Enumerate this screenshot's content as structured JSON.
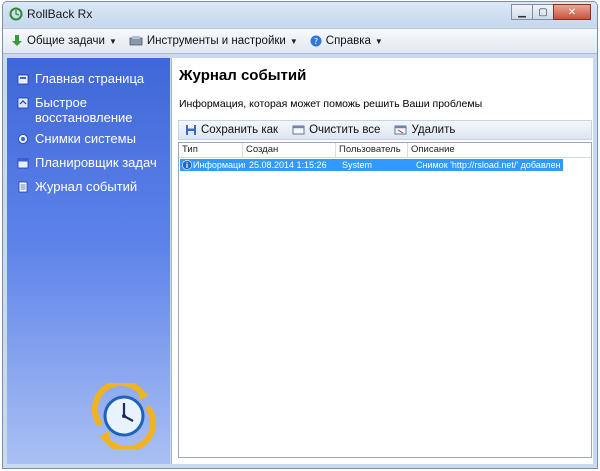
{
  "window": {
    "title": "RollBack Rx"
  },
  "menubar": [
    {
      "label": "Общие задачи",
      "icon": "download-arrow-icon"
    },
    {
      "label": "Инструменты и настройки",
      "icon": "tools-icon"
    },
    {
      "label": "Справка",
      "icon": "help-globe-icon"
    }
  ],
  "sidebar": {
    "items": [
      {
        "label": "Главная страница",
        "icon": "home-icon"
      },
      {
        "label": "Быстрое\nвосстановление",
        "label_line1": "Быстрое",
        "label_line2": "восстановление",
        "icon": "restore-icon"
      },
      {
        "label": "Снимки системы",
        "icon": "snapshot-icon"
      },
      {
        "label": "Планировщик задач",
        "icon": "scheduler-icon"
      },
      {
        "label": "Журнал событий",
        "icon": "log-icon"
      }
    ]
  },
  "main": {
    "title": "Журнал событий",
    "subtitle": "Информация, которая может поможь решить Ваши проблемы",
    "toolbar": [
      {
        "label": "Сохранить как",
        "icon": "save-icon"
      },
      {
        "label": "Очистить все",
        "icon": "clear-icon"
      },
      {
        "label": "Удалить",
        "icon": "delete-icon"
      }
    ],
    "table": {
      "columns": [
        "Тип",
        "Создан",
        "Пользователь",
        "Описание"
      ],
      "rows": [
        {
          "type": "Информация",
          "created": "25.08.2014 1:15:26",
          "user": "System",
          "description": "Снимок 'http://rsload.net/' добавлен"
        }
      ]
    }
  },
  "colors": {
    "sidebar_top": "#4067d8",
    "selection": "#3399ff"
  }
}
